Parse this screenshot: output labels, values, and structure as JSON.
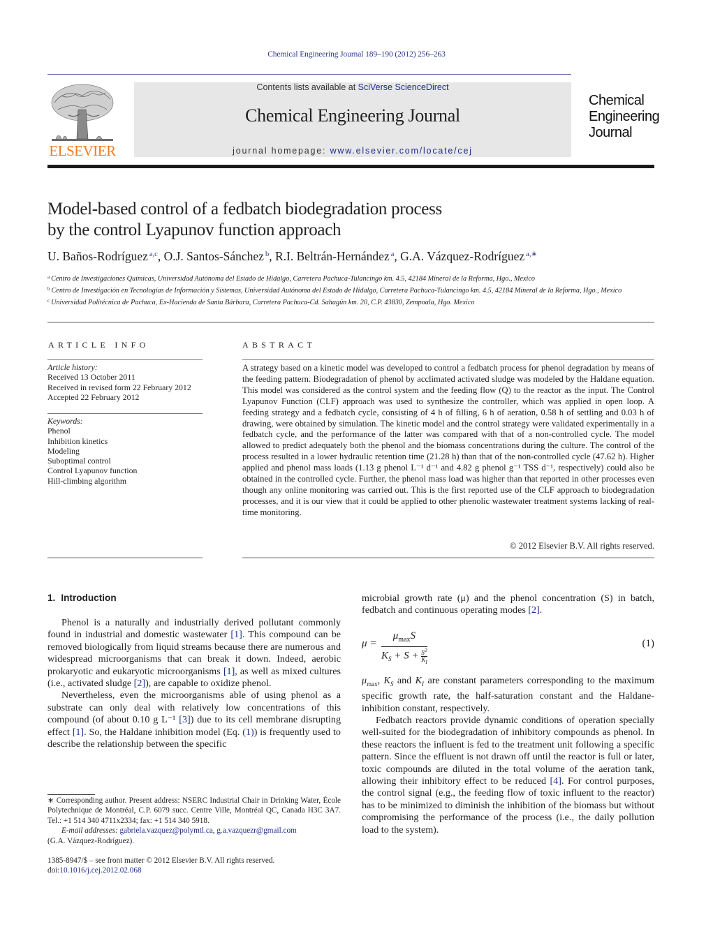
{
  "header": {
    "running_head": "Chemical Engineering Journal 189–190 (2012) 256–263",
    "publisher_logo_text": "ELSEVIER",
    "contents_prefix": "Contents lists available at ",
    "contents_link": "SciVerse ScienceDirect",
    "journal_title": "Chemical Engineering Journal",
    "homepage_prefix": "journal homepage: ",
    "homepage_link": "www.elsevier.com/locate/cej",
    "cover_title_lines": [
      "Chemical",
      "Engineering",
      "Journal"
    ],
    "colors": {
      "link": "#1f2e8a",
      "elsevier_orange": "#f07c22",
      "masthead_bg": "#e7e7e7"
    }
  },
  "article": {
    "title_lines": [
      "Model-based control of a fedbatch biodegradation process",
      "by the control Lyapunov function approach"
    ],
    "authors": [
      {
        "name": "U. Baños-Rodríguez",
        "sup": "a,c"
      },
      {
        "name": "O.J. Santos-Sánchez",
        "sup": "b"
      },
      {
        "name": "R.I. Beltrán-Hernández",
        "sup": "a"
      },
      {
        "name": "G.A. Vázquez-Rodríguez",
        "sup": "a,∗"
      }
    ],
    "affiliations": [
      {
        "mark": "a",
        "text": "Centro de Investigaciones Químicas, Universidad Autónoma del Estado de Hidalgo, Carretera Pachuca-Tulancingo km. 4.5, 42184 Mineral de la Reforma, Hgo., Mexico"
      },
      {
        "mark": "b",
        "text": "Centro de Investigación en Tecnologías de Información y Sistemas, Universidad Autónoma del Estado de Hidalgo, Carretera Pachuca-Tulancingo km. 4.5, 42184 Mineral de la Reforma, Hgo., Mexico"
      },
      {
        "mark": "c",
        "text": "Universidad Politécnica de Pachuca, Ex-Hacienda de Santa Bárbara, Carretera Pachuca-Cd. Sahagún km. 20, C.P. 43830, Zempoala, Hgo. Mexico"
      }
    ]
  },
  "article_info": {
    "heading": "ARTICLE INFO",
    "history_label": "Article history:",
    "history": [
      "Received 13 October 2011",
      "Received in revised form 22 February 2012",
      "Accepted 22 February 2012"
    ],
    "keywords_label": "Keywords:",
    "keywords": [
      "Phenol",
      "Inhibition kinetics",
      "Modeling",
      "Suboptimal control",
      "Control Lyapunov function",
      "Hill-climbing algorithm"
    ]
  },
  "abstract": {
    "heading": "ABSTRACT",
    "text": "A strategy based on a kinetic model was developed to control a fedbatch process for phenol degradation by means of the feeding pattern. Biodegradation of phenol by acclimated activated sludge was modeled by the Haldane equation. This model was considered as the control system and the feeding flow (Q) to the reactor as the input. The Control Lyapunov Function (CLF) approach was used to synthesize the controller, which was applied in open loop. A feeding strategy and a fedbatch cycle, consisting of 4 h of filling, 6 h of aeration, 0.58 h of settling and 0.03 h of drawing, were obtained by simulation. The kinetic model and the control strategy were validated experimentally in a fedbatch cycle, and the performance of the latter was compared with that of a non-controlled cycle. The model allowed to predict adequately both the phenol and the biomass concentrations during the culture. The control of the process resulted in a lower hydraulic retention time (21.28 h) than that of the non-controlled cycle (47.62 h). Higher applied and phenol mass loads (1.13 g phenol L⁻¹ d⁻¹ and 4.82 g phenol g⁻¹ TSS d⁻¹, respectively) could also be obtained in the controlled cycle. Further, the phenol mass load was higher than that reported in other processes even though any online monitoring was carried out. This is the first reported use of the CLF approach to biodegradation processes, and it is our view that it could be applied to other phenolic wastewater treatment systems lacking of real-time monitoring.",
    "copyright": "© 2012 Elsevier B.V. All rights reserved."
  },
  "introduction": {
    "number": "1.",
    "heading": "Introduction",
    "p1": [
      {
        "t": "Phenol is a naturally and industrially derived pollutant commonly found in industrial and domestic wastewater "
      },
      {
        "ref": "[1]"
      },
      {
        "t": ". This compound can be removed biologically from liquid streams because there are numerous and widespread microorganisms that can break it down. Indeed, aerobic prokaryotic and eukaryotic microorganisms "
      },
      {
        "ref": "[1]"
      },
      {
        "t": ", as well as mixed cultures (i.e., activated sludge "
      },
      {
        "ref": "[2]"
      },
      {
        "t": "), are capable to oxidize phenol."
      }
    ],
    "p2": [
      {
        "t": "Nevertheless, even the microorganisms able of using phenol as a substrate can only deal with relatively low concentrations of this compound (of about 0.10 g L⁻¹ "
      },
      {
        "ref": "[3]"
      },
      {
        "t": ") due to its cell membrane disrupting effect "
      },
      {
        "ref": "[1]"
      },
      {
        "t": ". So, the Haldane inhibition model (Eq. "
      },
      {
        "ref": "(1)"
      },
      {
        "t": ") is frequently used to describe the relationship between the specific"
      }
    ],
    "p3": [
      {
        "t": "microbial growth rate (μ) and the phenol concentration (S) in batch, fedbatch and continuous operating modes "
      },
      {
        "ref": "[2]"
      },
      {
        "t": "."
      }
    ],
    "equation": {
      "lhs": "μ =",
      "numerator": "μmaxS",
      "denominator": "KS + S + S²/KI",
      "number": "(1)"
    },
    "p4": "μmax, KS and KI are constant parameters corresponding to the maximum specific growth rate, the half-saturation constant and the Haldane-inhibition constant, respectively.",
    "p5": [
      {
        "t": "Fedbatch reactors provide dynamic conditions of operation specially well-suited for the biodegradation of inhibitory compounds as phenol. In these reactors the influent is fed to the treatment unit following a specific pattern. Since the effluent is not drawn off until the reactor is full or later, toxic compounds are diluted in the total volume of the aeration tank, allowing their inhibitory effect to be reduced "
      },
      {
        "ref": "[4]"
      },
      {
        "t": ". For control purposes, the control signal (e.g., the feeding flow of toxic influent to the reactor) has to be minimized to diminish the inhibition of the biomass but without compromising the performance of the process (i.e., the daily pollution load to the system)."
      }
    ]
  },
  "footnotes": {
    "corresponding": "∗ Corresponding author. Present address: NSERC Industrial Chair in Drinking Water, École Polytechnique de Montréal, C.P. 6079 succ. Centre Ville, Montréal QC, Canada H3C 3A7. Tel.: +1 514 340 4711x2334; fax: +1 514 340 5918.",
    "email_label": "E-mail addresses:",
    "emails": [
      "gabriela.vazquez@polymtl.ca",
      "g.a.vazquezr@gmail.com"
    ],
    "email_owner": "(G.A. Vázquez-Rodríguez).",
    "front_matter": "1385-8947/$ – see front matter © 2012 Elsevier B.V. All rights reserved.",
    "doi_prefix": "doi:",
    "doi": "10.1016/j.cej.2012.02.068"
  }
}
